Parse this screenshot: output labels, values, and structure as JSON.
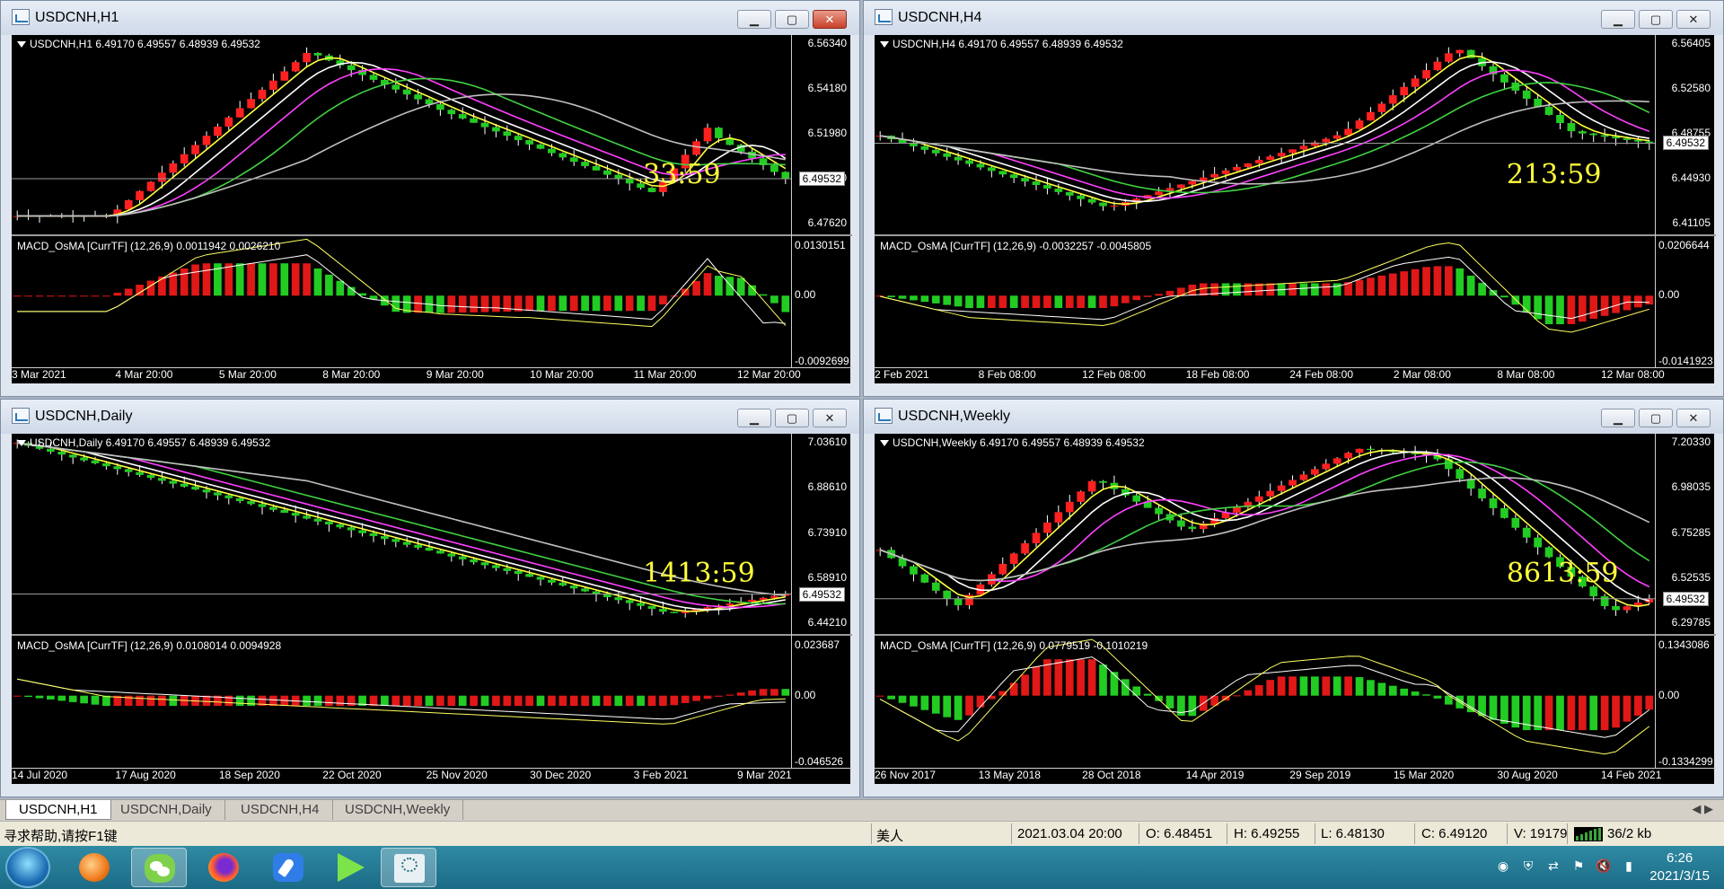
{
  "windows": [
    {
      "id": "h1",
      "title": "USDCNH,H1",
      "header": "USDCNH,H1  6.49170 6.49557 6.48939 6.49532",
      "price_ticks": [
        "6.56340",
        "6.54180",
        "6.51980",
        "6.49780",
        "6.47620"
      ],
      "current_price": "6.49532",
      "timer": "33:59",
      "macd_header": "MACD_OsMA [CurrTF] (12,26,9) 0.0011942 0.0026210",
      "macd_ticks": [
        "0.0130151",
        "0.00",
        "-0.0092699"
      ],
      "x_labels": [
        "3 Mar 2021",
        "4 Mar 20:00",
        "5 Mar 20:00",
        "8 Mar 20:00",
        "9 Mar 20:00",
        "10 Mar 20:00",
        "11 Mar 20:00",
        "12 Mar 20:00"
      ],
      "closable_red": true
    },
    {
      "id": "h4",
      "title": "USDCNH,H4",
      "header": "USDCNH,H4  6.49170 6.49557 6.48939 6.49532",
      "price_ticks": [
        "6.56405",
        "6.52580",
        "6.48755",
        "6.44930",
        "6.41105"
      ],
      "current_price": "6.49532",
      "timer": "213:59",
      "macd_header": "MACD_OsMA [CurrTF] (12,26,9) -0.0032257 -0.0045805",
      "macd_ticks": [
        "0.0206644",
        "0.00",
        "-0.0141923"
      ],
      "x_labels": [
        "2 Feb 2021",
        "8 Feb 08:00",
        "12 Feb 08:00",
        "18 Feb 08:00",
        "24 Feb 08:00",
        "2 Mar 08:00",
        "8 Mar 08:00",
        "12 Mar 08:00"
      ],
      "closable_red": false
    },
    {
      "id": "daily",
      "title": "USDCNH,Daily",
      "header": "USDCNH,Daily  6.49170 6.49557 6.48939 6.49532",
      "price_ticks": [
        "7.03610",
        "6.88610",
        "6.73910",
        "6.58910",
        "6.44210"
      ],
      "current_price": "6.49532",
      "timer": "1413:59",
      "macd_header": "MACD_OsMA [CurrTF] (12,26,9) 0.0108014 0.0094928",
      "macd_ticks": [
        "0.023687",
        "0.00",
        "-0.046526"
      ],
      "x_labels": [
        "14 Jul 2020",
        "17 Aug 2020",
        "18 Sep 2020",
        "22 Oct 2020",
        "25 Nov 2020",
        "30 Dec 2020",
        "3 Feb 2021",
        "9 Mar 2021"
      ],
      "closable_red": false
    },
    {
      "id": "weekly",
      "title": "USDCNH,Weekly",
      "header": "USDCNH,Weekly  6.49170 6.49557 6.48939 6.49532",
      "price_ticks": [
        "7.20330",
        "6.98035",
        "6.75285",
        "6.52535",
        "6.29785"
      ],
      "current_price": "6.49532",
      "timer": "8613:59",
      "macd_header": "MACD_OsMA [CurrTF] (12,26,9) 0.0779519 -0.1010219",
      "macd_ticks": [
        "0.1343086",
        "0.00",
        "-0.1334299"
      ],
      "x_labels": [
        "26 Nov 2017",
        "13 May 2018",
        "28 Oct 2018",
        "14 Apr 2019",
        "29 Sep 2019",
        "15 Mar 2020",
        "30 Aug 2020",
        "14 Feb 2021"
      ],
      "closable_red": false
    }
  ],
  "tabs": [
    "USDCNH,H1",
    "USDCNH,Daily",
    "USDCNH,H4",
    "USDCNH,Weekly"
  ],
  "active_tab": 0,
  "status": {
    "help": "寻求帮助,请按F1键",
    "profile": "美人",
    "datetime": "2021.03.04 20:00",
    "open": "O: 6.48451",
    "high": "H: 6.49255",
    "low": "L: 6.48130",
    "close": "C: 6.49120",
    "volume": "V: 19179",
    "traffic": "36/2 kb"
  },
  "clock": {
    "time": "6:26",
    "date": "2021/3/15"
  },
  "icons": [
    "windows-start-icon",
    "browser-orange-icon",
    "wechat-icon",
    "firefox-icon",
    "feather-icon",
    "media-player-icon",
    "app-logo-icon"
  ]
}
